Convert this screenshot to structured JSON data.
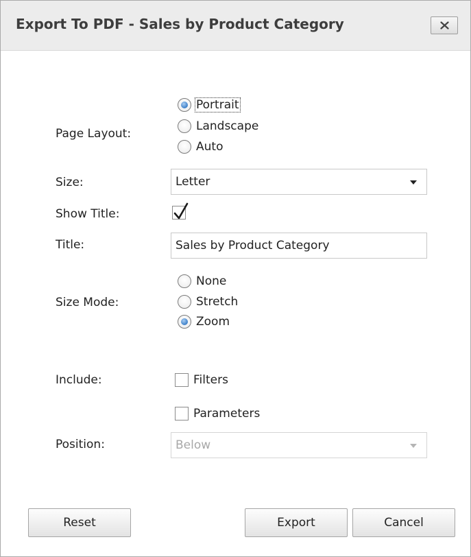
{
  "dialog": {
    "title": "Export To PDF - Sales by Product Category",
    "close_label": "x"
  },
  "page_layout": {
    "label": "Page Layout:",
    "options": [
      "Portrait",
      "Landscape",
      "Auto"
    ],
    "selected": "Portrait"
  },
  "size": {
    "label": "Size:",
    "value": "Letter"
  },
  "show_title": {
    "label": "Show Title:",
    "checked": true
  },
  "title_field": {
    "label": "Title:",
    "value": "Sales by Product Category"
  },
  "size_mode": {
    "label": "Size Mode:",
    "options": [
      "None",
      "Stretch",
      "Zoom"
    ],
    "selected": "Zoom"
  },
  "include": {
    "label": "Include:",
    "options": [
      {
        "label": "Filters",
        "checked": false
      },
      {
        "label": "Parameters",
        "checked": false
      }
    ]
  },
  "position": {
    "label": "Position:",
    "value": "Below",
    "disabled": true
  },
  "buttons": {
    "reset": "Reset",
    "export": "Export",
    "cancel": "Cancel"
  }
}
